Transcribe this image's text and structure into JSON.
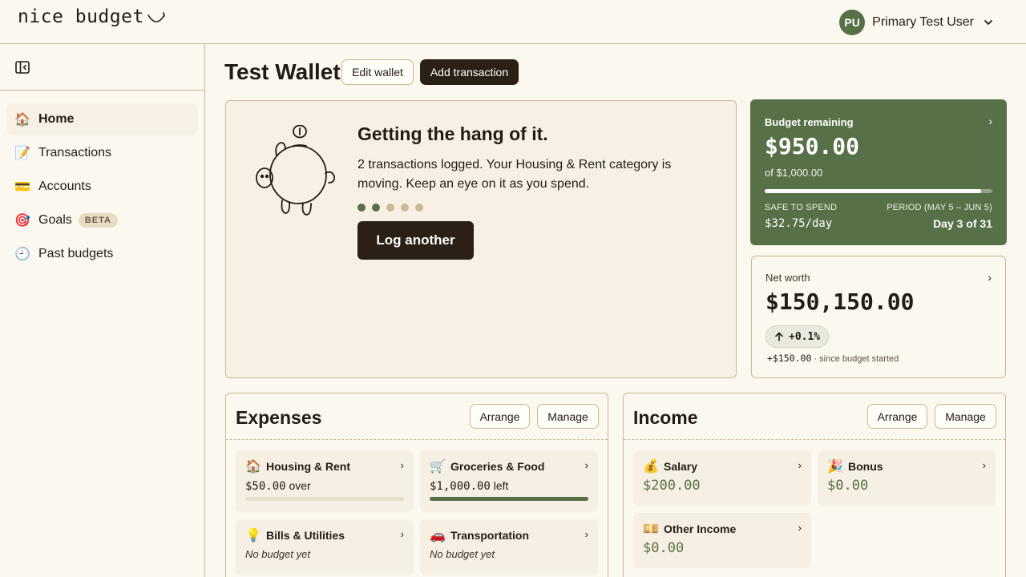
{
  "app": {
    "logo_text": "nice budget"
  },
  "user": {
    "initials": "PU",
    "name": "Primary Test User"
  },
  "sidebar": {
    "items": [
      {
        "emoji": "🏠",
        "label": "Home",
        "active": true
      },
      {
        "emoji": "📝",
        "label": "Transactions"
      },
      {
        "emoji": "💳",
        "label": "Accounts"
      },
      {
        "emoji": "🎯",
        "label": "Goals",
        "badge": "BETA"
      },
      {
        "emoji": "🕘",
        "label": "Past budgets"
      }
    ]
  },
  "header": {
    "title": "Test Wallet",
    "edit_label": "Edit wallet",
    "add_label": "Add transaction"
  },
  "hero": {
    "title": "Getting the hang of it.",
    "message": "2 transactions logged. Your Housing & Rent category is moving. Keep an eye on it as you spend.",
    "progress_steps_done": 2,
    "progress_steps_total": 5,
    "cta_label": "Log another"
  },
  "budget": {
    "label": "Budget remaining",
    "amount": "$950.00",
    "of": "of $1,000.00",
    "spent_fraction": 0.05,
    "safe_label": "SAFE TO SPEND",
    "rate": "$32.75/day",
    "period_label": "PERIOD (MAY 5 – JUN 5)",
    "day_label": "Day 3 of 31",
    "chevron": "›"
  },
  "networth": {
    "label": "Net worth",
    "amount": "$150,150.00",
    "change_pct": "+0.1%",
    "change_amount": "+$150.00",
    "since": " · since budget started",
    "chevron": "›"
  },
  "expenses": {
    "title": "Expenses",
    "arrange_label": "Arrange",
    "manage_label": "Manage",
    "categories": [
      {
        "emoji": "🏠",
        "name": "Housing & Rent",
        "amount": "$50.00",
        "suffix": " over",
        "fill": 0
      },
      {
        "emoji": "🛒",
        "name": "Groceries & Food",
        "amount": "$1,000.00",
        "suffix": " left",
        "fill": 1
      },
      {
        "emoji": "💡",
        "name": "Bills & Utilities",
        "empty": "No budget yet"
      },
      {
        "emoji": "🚗",
        "name": "Transportation",
        "empty": "No budget yet"
      }
    ]
  },
  "income": {
    "title": "Income",
    "arrange_label": "Arrange",
    "manage_label": "Manage",
    "categories": [
      {
        "emoji": "💰",
        "name": "Salary",
        "amount": "$200.00"
      },
      {
        "emoji": "🎉",
        "name": "Bonus",
        "amount": "$0.00"
      },
      {
        "emoji": "💴",
        "name": "Other Income",
        "amount": "$0.00"
      }
    ]
  },
  "colors": {
    "accent_green": "#587047",
    "dark_button": "#2a2016",
    "border": "#c9b994",
    "dot_active": "#587047",
    "dot_inactive": "#c9b994"
  }
}
